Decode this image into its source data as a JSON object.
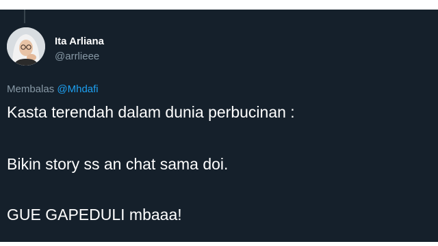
{
  "tweet": {
    "author": {
      "name": "Ita Arliana",
      "handle": "@arrlieee"
    },
    "reply_context": {
      "prefix": "Membalas",
      "mention": "@Mhdafi"
    },
    "lines": [
      "Kasta terendah dalam dunia perbucinan :",
      "Bikin story ss an chat sama doi.",
      "GUE GAPEDULI mbaaa!"
    ]
  },
  "colors": {
    "background": "#15202b",
    "text": "#ffffff",
    "muted": "#8899a6",
    "link": "#1da1f2"
  },
  "icons": {
    "avatar": "profile-photo"
  }
}
